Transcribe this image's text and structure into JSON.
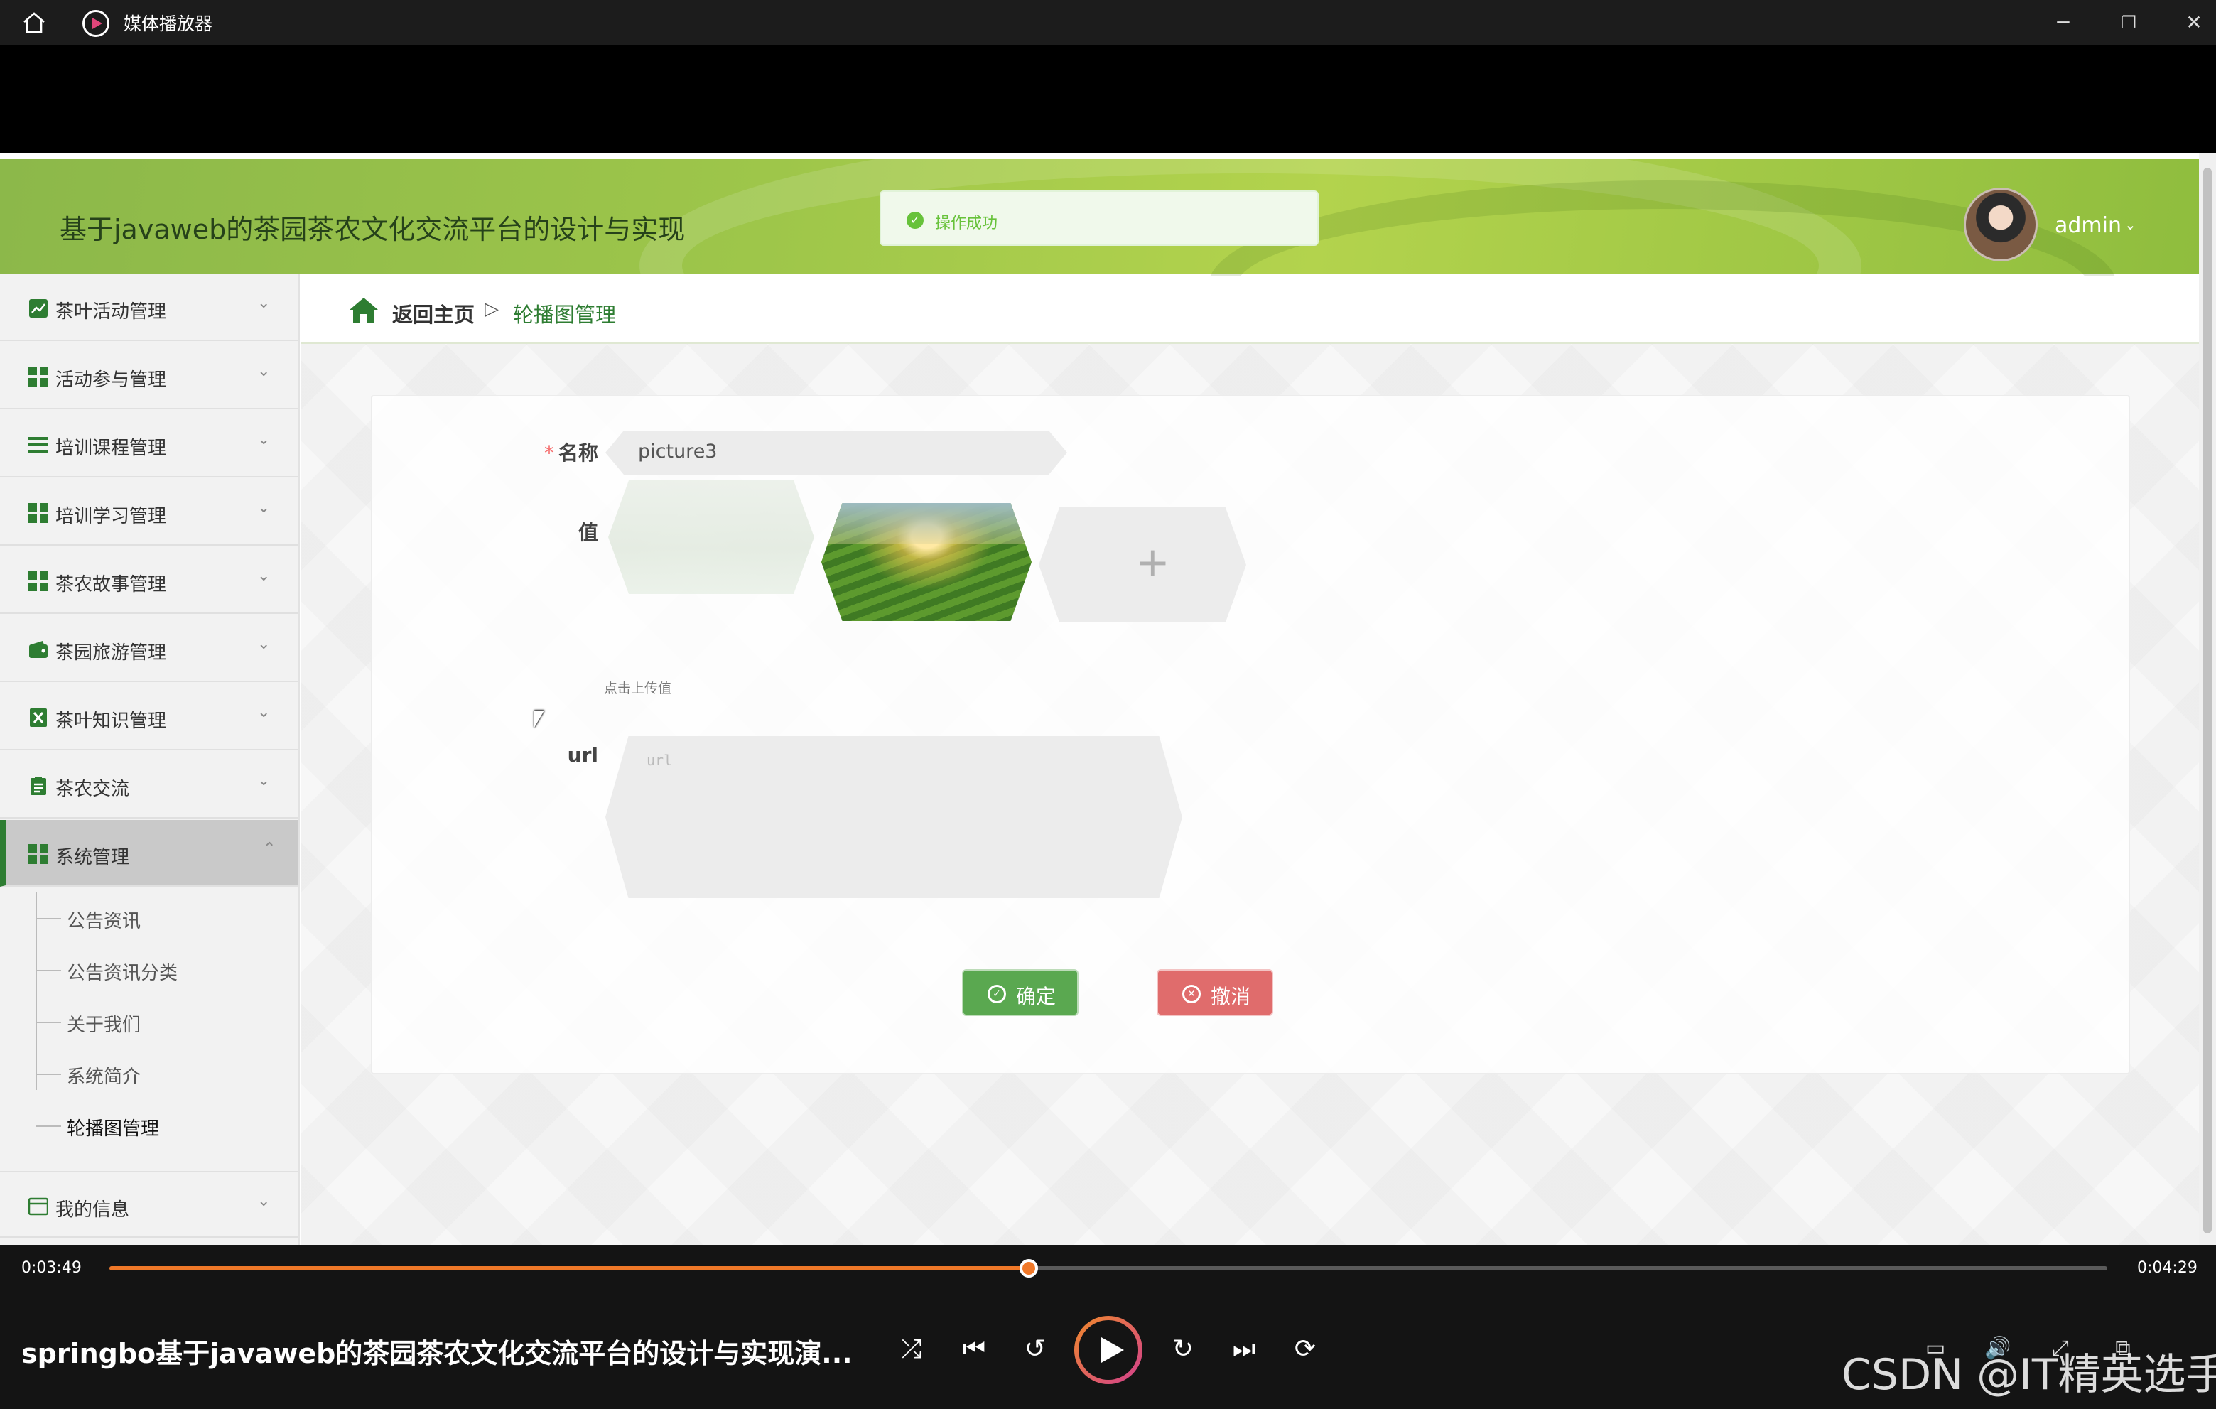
{
  "window": {
    "app_title": "媒体播放器",
    "controls": {
      "minimize": "─",
      "restore": "❐",
      "close": "✕"
    }
  },
  "site": {
    "title": "基于javaweb的茶园茶农文化交流平台的设计与实现",
    "toast": {
      "icon": "check-circle-icon",
      "text": "操作成功",
      "color": "#67c23a"
    },
    "user": {
      "name": "admin",
      "caret": "⌄"
    }
  },
  "sidebar": {
    "items": [
      {
        "label": "茶叶活动管理",
        "icon": "chart-icon"
      },
      {
        "label": "活动参与管理",
        "icon": "grid-icon"
      },
      {
        "label": "培训课程管理",
        "icon": "list-icon"
      },
      {
        "label": "培训学习管理",
        "icon": "grid-icon"
      },
      {
        "label": "茶农故事管理",
        "icon": "grid-icon"
      },
      {
        "label": "茶园旅游管理",
        "icon": "wallet-icon"
      },
      {
        "label": "茶叶知识管理",
        "icon": "excel-icon"
      },
      {
        "label": "茶农交流",
        "icon": "clipboard-icon"
      },
      {
        "label": "系统管理",
        "icon": "grid-icon"
      }
    ],
    "sub_items": [
      "公告资讯",
      "公告资讯分类",
      "关于我们",
      "系统简介",
      "轮播图管理"
    ],
    "last_item": {
      "label": "我的信息",
      "icon": "card-icon"
    },
    "caret_down": "⌄",
    "caret_up": "⌃",
    "accent": "#2e7d32"
  },
  "breadcrumb": {
    "home": "返回主页",
    "separator": "▷",
    "current": "轮播图管理"
  },
  "form": {
    "name_label": "名称",
    "required_mark": "*",
    "name_value": "picture3",
    "value_label": "值",
    "upload_plus": "+",
    "upload_hint": "点击上传值",
    "url_label": "url",
    "url_placeholder": "url",
    "confirm_label": "确定",
    "cancel_label": "撤消",
    "confirm_color": "#5aa850",
    "cancel_color": "#e06c6c"
  },
  "player": {
    "current_time": "0:03:49",
    "total_time": "0:04:29",
    "progress": 0.46,
    "media_title": "springbo基于javaweb的茶园茶农文化交流平台的设计与实现演...",
    "controls": {
      "shuffle": "⤮",
      "prev": "⏮",
      "back10": "↺",
      "forward30": "↻",
      "next": "⏭",
      "repeat": "⟳"
    },
    "right_controls": {
      "subtitles": "▭",
      "volume": "🔊",
      "expand": "⤢",
      "miniplayer": "⧉"
    },
    "accent": "#f07828"
  },
  "watermark": "CSDN @IT精英选手"
}
